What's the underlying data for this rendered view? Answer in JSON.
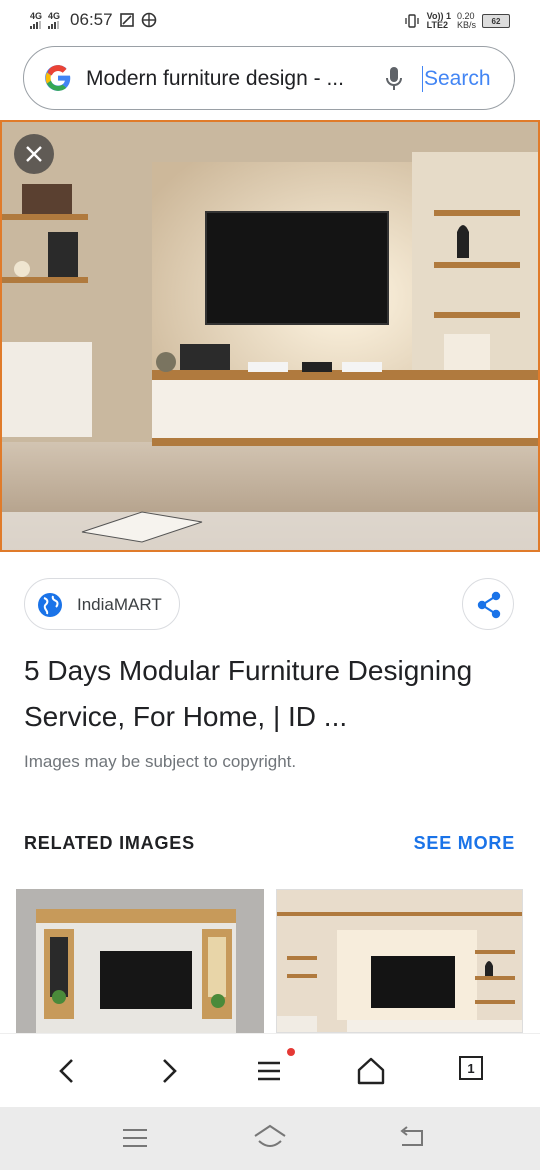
{
  "status_bar": {
    "network1": "4G",
    "network2": "4G",
    "time": "06:57",
    "volte": "Vo)) 1",
    "lte": "LTE2",
    "speed_value": "0.20",
    "speed_unit": "KB/s",
    "battery": "62"
  },
  "search": {
    "query": "Modern furniture design - ...",
    "button_label": "Search"
  },
  "result": {
    "source": "IndiaMART",
    "title": "5 Days Modular Furniture Designing Service, For Home, | ID ...",
    "copyright_note": "Images may be subject to copyright."
  },
  "related": {
    "heading": "RELATED IMAGES",
    "see_more": "SEE MORE"
  },
  "browser_toolbar": {
    "tab_count": "1"
  },
  "colors": {
    "accent": "#1a73e8",
    "hero_border": "#e07b2a",
    "notification_dot": "#e53935"
  },
  "icons": [
    "google-logo-icon",
    "mic-icon",
    "close-icon",
    "globe-icon",
    "share-icon",
    "back-arrow-icon",
    "forward-arrow-icon",
    "menu-icon",
    "home-icon",
    "tabs-icon",
    "recents-icon",
    "system-home-icon",
    "system-back-icon"
  ]
}
